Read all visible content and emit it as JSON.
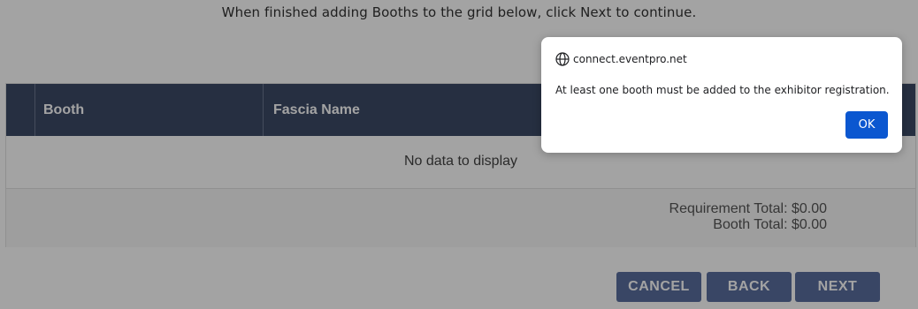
{
  "page": {
    "instruction": "When finished adding Booths to the grid below, click Next to continue."
  },
  "grid": {
    "columns": [
      "Booth",
      "Fascia Name"
    ],
    "empty_text": "No data to display",
    "requirement_total": "Requirement Total: $0.00",
    "booth_total": "Booth Total: $0.00"
  },
  "buttons": {
    "cancel": "CANCEL",
    "back": "BACK",
    "next": "NEXT"
  },
  "dialog": {
    "origin": "connect.eventpro.net",
    "message": "At least one booth must be added to the exhibitor registration.",
    "ok_label": "OK",
    "icon": "globe-icon"
  },
  "colors": {
    "header_bg": "#3c4a66",
    "button_bg": "#5a6e9e",
    "ok_bg": "#0b57d0"
  }
}
